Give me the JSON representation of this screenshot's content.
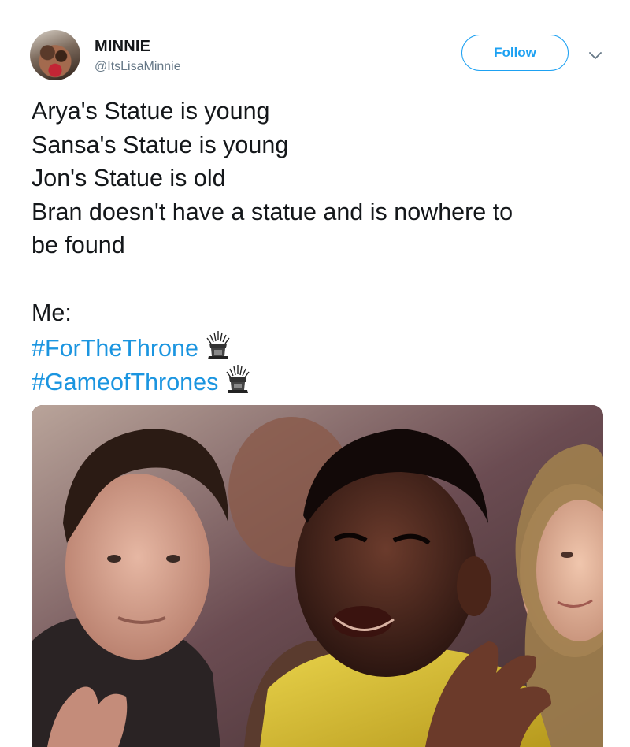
{
  "user": {
    "display_name": "MINNIE",
    "handle": "@ItsLisaMinnie",
    "avatar_icon": "profile-photo"
  },
  "actions": {
    "follow_label": "Follow",
    "menu_icon": "chevron-down-icon"
  },
  "tweet": {
    "lines": [
      "Arya's Statue is young",
      "Sansa's Statue is young",
      "Jon's Statue is old",
      "Bran doesn't have a statue and is nowhere to",
      "be found",
      "Me:"
    ],
    "hashtags": [
      "#ForTheThrone",
      "#GameofThrones"
    ],
    "hashtag_emoji": "iron-throne-icon"
  },
  "colors": {
    "link": "#1b95e0",
    "follow_border": "#1da1f2",
    "secondary_text": "#657786",
    "text": "#14171a"
  },
  "media": {
    "type": "gif",
    "description_icon": "photo-crowd-scene"
  }
}
